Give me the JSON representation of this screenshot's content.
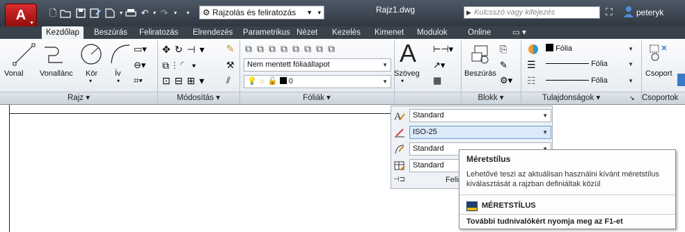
{
  "app": {
    "logo_letter": "A"
  },
  "quick_access": {
    "workspace": "Rajzolás és feliratozás",
    "icons": [
      "new-icon",
      "open-icon",
      "save-icon",
      "save-as-icon",
      "plot-icon",
      "print-icon",
      "undo-icon",
      "redo-icon",
      "gear-icon"
    ]
  },
  "document_title": "Rajz1.dwg",
  "search": {
    "placeholder": "Kulcsszó vagy kifejezés"
  },
  "user": {
    "name": "peteryk"
  },
  "tabs": [
    "Kezdőlap",
    "Beszúrás",
    "Feliratozás",
    "Elrendezés",
    "Parametrikus",
    "Nézet",
    "Kezelés",
    "Kimenet",
    "Modulok",
    "Online",
    "▭ ▾"
  ],
  "panels": {
    "rajz": {
      "title": "Rajz ▾",
      "tools": [
        "Vonal",
        "Vonallánc",
        "Kör",
        "Ív"
      ]
    },
    "modositas": {
      "title": "Módosítás ▾"
    },
    "foliak": {
      "title": "Fóliák ▾",
      "layer_state": "Nem mentett fóliaállapot",
      "layer_value": "0"
    },
    "felirat": {
      "button": "Szöveg",
      "title": "Felir"
    },
    "blokk": {
      "title": "Blokk ▾",
      "button": "Beszúrás"
    },
    "tulajdonsagok": {
      "title": "Tulajdonságok ▾",
      "color": "Fólia",
      "linetype": "Fólia",
      "lineweight": "Fólia"
    },
    "csoport": {
      "title": "Csoportok",
      "button": "Csoport"
    }
  },
  "dropdown": {
    "rows": [
      "Standard",
      "ISO-25",
      "Standard",
      "Standard"
    ],
    "footer": "Felir"
  },
  "tooltip": {
    "title": "Méretstílus",
    "description": "Lehetővé teszi az aktuálisan használni kívánt méretstílus kiválasztását a rajzban definiáltak közül",
    "command": "MÉRETSTÍLUS",
    "help": "További tudnivalókért nyomja meg az F1-et"
  },
  "colors": {
    "accent": "#3b79c8",
    "titlebar": "#3a424c",
    "app_red": "#c71f1f"
  }
}
